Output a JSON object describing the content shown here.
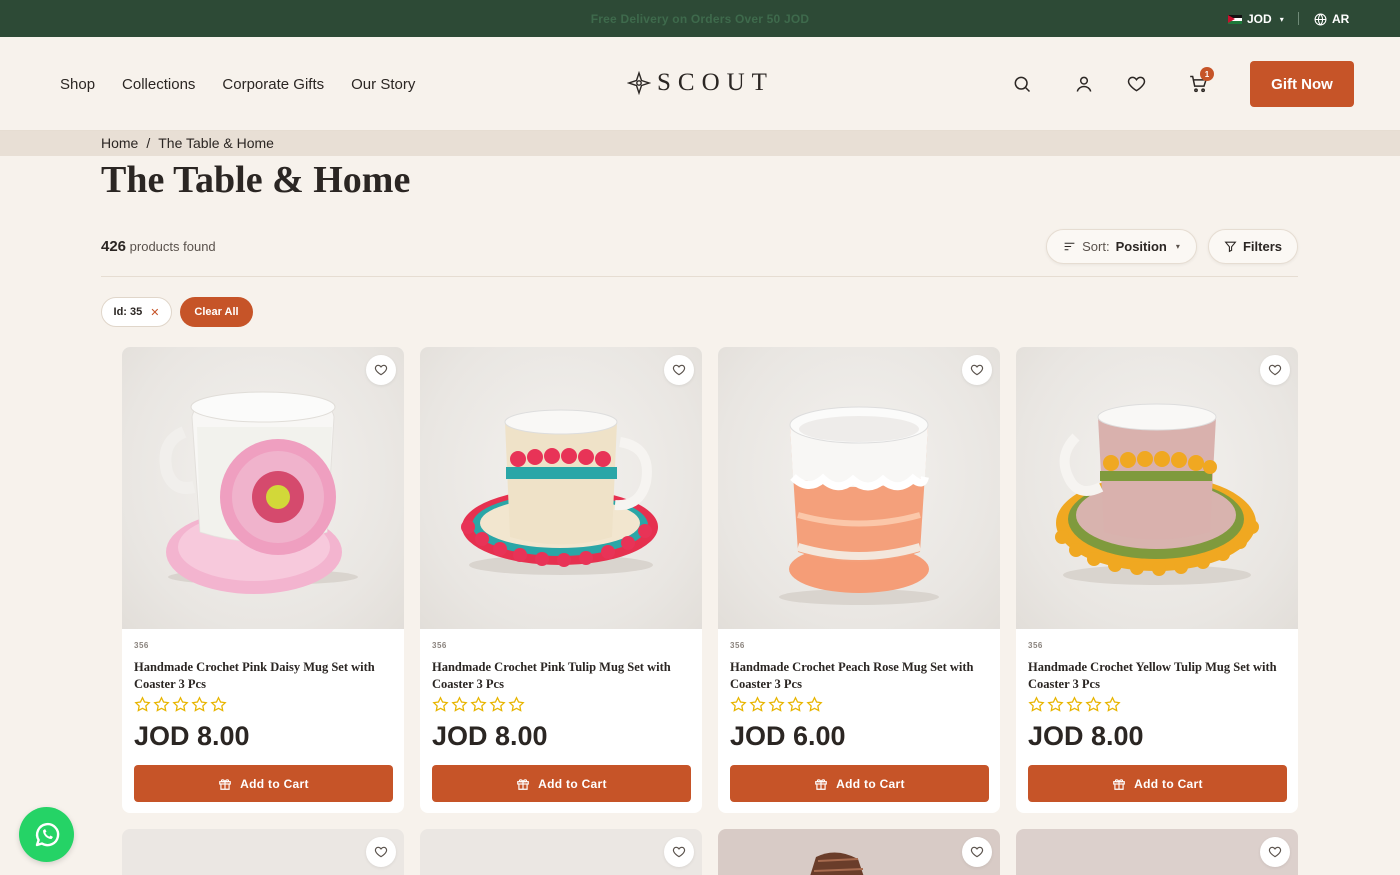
{
  "topbar": {
    "message": "Free Delivery on Orders Over 50 JOD",
    "currency": "JOD",
    "language": "AR"
  },
  "header": {
    "nav": [
      "Shop",
      "Collections",
      "Corporate Gifts",
      "Our Story"
    ],
    "logo": "SCOUT",
    "cart_count": "1",
    "cta": "Gift Now"
  },
  "breadcrumb": {
    "home": "Home",
    "separator": "/",
    "current": "The Table & Home"
  },
  "page": {
    "title": "The Table & Home",
    "count": "426",
    "count_label": "products found",
    "sort_label": "Sort:",
    "sort_value": "Position",
    "filters_label": "Filters",
    "active_filter": "Id: 35",
    "clear_all": "Clear All"
  },
  "products": [
    {
      "sku": "356",
      "name": "Handmade Crochet Pink Daisy Mug Set with Coaster 3 Pcs",
      "price": "JOD 8.00",
      "rating": 0,
      "cta": "Add to Cart"
    },
    {
      "sku": "356",
      "name": "Handmade Crochet Pink Tulip Mug Set with Coaster 3 Pcs",
      "price": "JOD 8.00",
      "rating": 0,
      "cta": "Add to Cart"
    },
    {
      "sku": "356",
      "name": "Handmade Crochet Peach Rose Mug Set with Coaster 3 Pcs",
      "price": "JOD 6.00",
      "rating": 0,
      "cta": "Add to Cart"
    },
    {
      "sku": "356",
      "name": "Handmade Crochet Yellow Tulip Mug Set with Coaster 3 Pcs",
      "price": "JOD 8.00",
      "rating": 0,
      "cta": "Add to Cart"
    }
  ],
  "colors": {
    "topbar": "#2d4a36",
    "accent": "#c65428",
    "background": "#f7f2ec",
    "star": "#e8b500",
    "whatsapp": "#25d366"
  },
  "icons": [
    "globe-icon",
    "search-icon",
    "user-icon",
    "heart-icon",
    "cart-icon",
    "sort-icon",
    "filter-icon",
    "gift-icon",
    "whatsapp-icon",
    "star-icon"
  ]
}
